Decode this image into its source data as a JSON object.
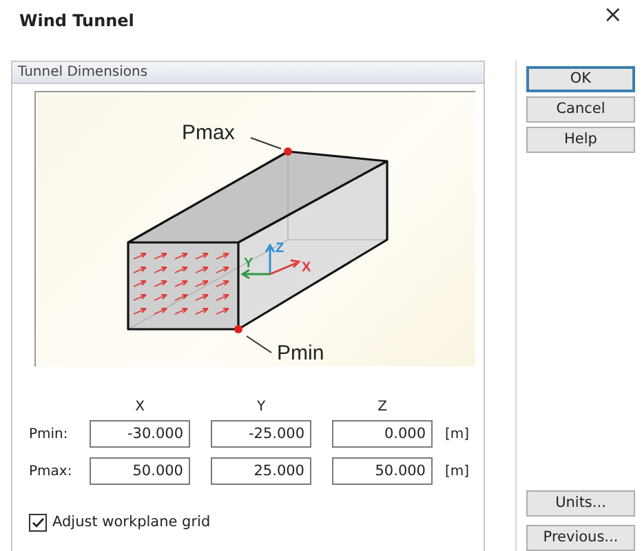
{
  "window": {
    "title": "Wind Tunnel",
    "close": "×"
  },
  "group": {
    "title": "Tunnel Dimensions"
  },
  "diagram": {
    "pmax_label": "Pmax",
    "pmin_label": "Pmin",
    "axis_labels": [
      "X",
      "Y",
      "Z"
    ]
  },
  "columns": [
    "X",
    "Y",
    "Z"
  ],
  "rows": [
    {
      "label": "Pmin:",
      "values": [
        "-30.000",
        "-25.000",
        "0.000"
      ],
      "unit": "[m]"
    },
    {
      "label": "Pmax:",
      "values": [
        "50.000",
        "25.000",
        "50.000"
      ],
      "unit": "[m]"
    }
  ],
  "checkbox": {
    "label": "Adjust workplane grid",
    "checked": true
  },
  "buttons_top": [
    {
      "label": "OK",
      "default": true
    },
    {
      "label": "Cancel",
      "default": false
    },
    {
      "label": "Help",
      "default": false
    }
  ],
  "buttons_bottom": [
    {
      "label": "Units...",
      "default": false
    },
    {
      "label": "Previous...",
      "default": false
    }
  ]
}
